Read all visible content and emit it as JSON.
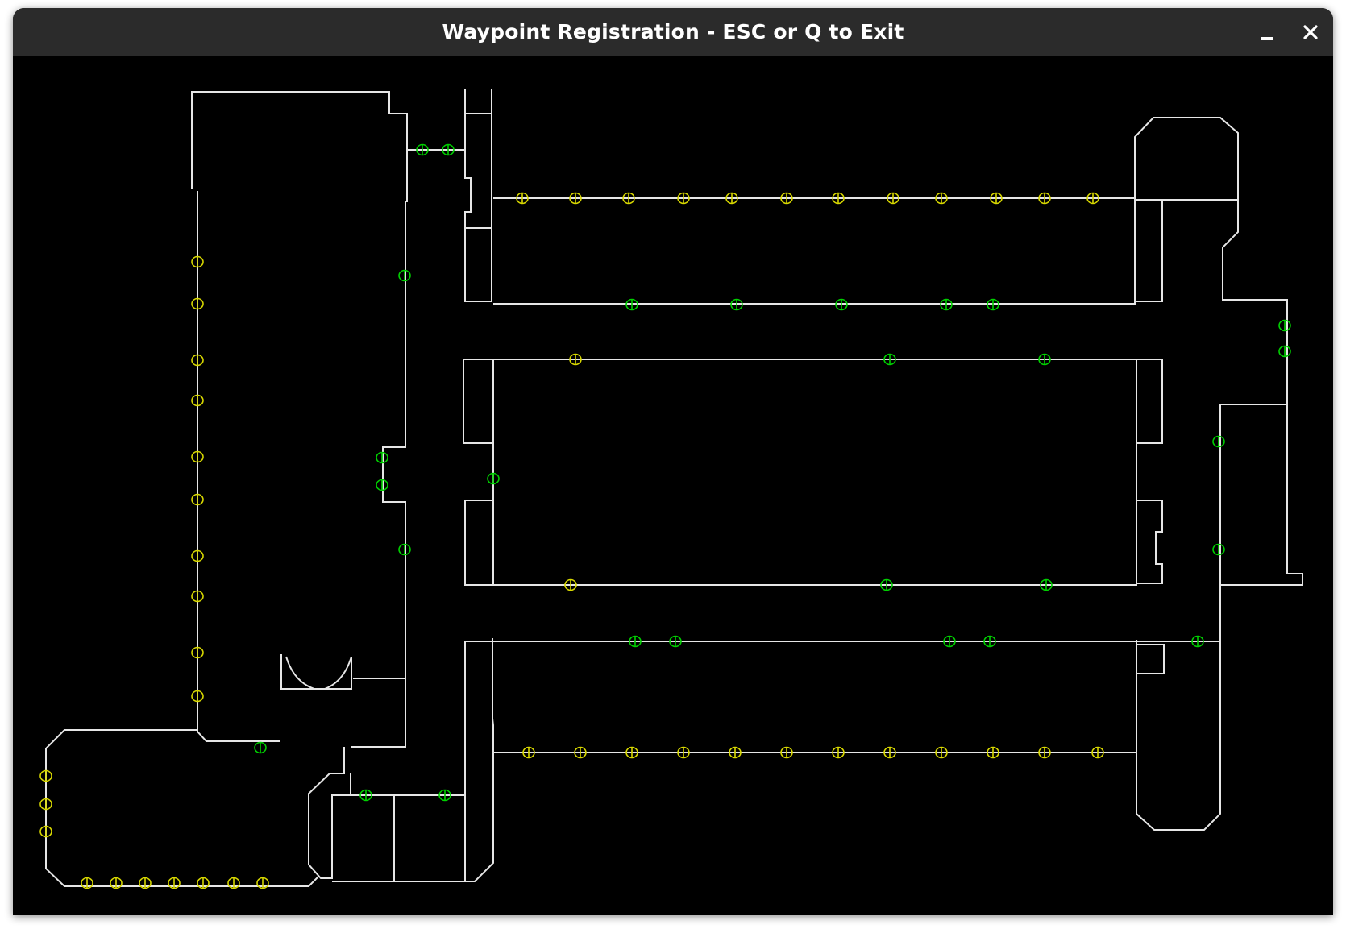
{
  "window": {
    "title": "Waypoint Registration - ESC or Q to Exit",
    "minimize_icon": "minimize-icon",
    "close_icon": "close-icon"
  },
  "map": {
    "background_color": "#000000",
    "wall_color": "#e6e6e6",
    "waypoint_colors": {
      "yellow": "#d8d800",
      "green": "#00d000"
    }
  }
}
